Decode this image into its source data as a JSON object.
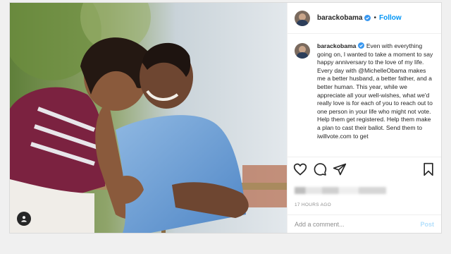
{
  "header": {
    "username": "barackobama",
    "separator": "•",
    "follow_label": "Follow"
  },
  "caption": {
    "username": "barackobama",
    "text": "Even with everything going on, I wanted to take a moment to say happy anniversary to the love of my life. Every day with @MichelleObama makes me a better husband, a better father, and a better human. This year, while we appreciate all your well-wishes, what we'd really love is for each of you to reach out to one person in your life who might not vote. Help them get registered. Help them make a plan to cast their ballot. Send them to iwillvote.com to get"
  },
  "timestamp": "17 HOURS AGO",
  "comment": {
    "placeholder": "Add a comment...",
    "post_label": "Post"
  },
  "icons": {
    "verified": "verified-badge-icon",
    "like": "heart-icon",
    "comment": "speech-bubble-icon",
    "share": "paper-plane-icon",
    "save": "bookmark-icon",
    "tag": "user-tag-icon"
  },
  "colors": {
    "accent": "#0095f6",
    "post_disabled": "#b2dffc",
    "text": "#262626",
    "muted": "#8e8e8e"
  }
}
